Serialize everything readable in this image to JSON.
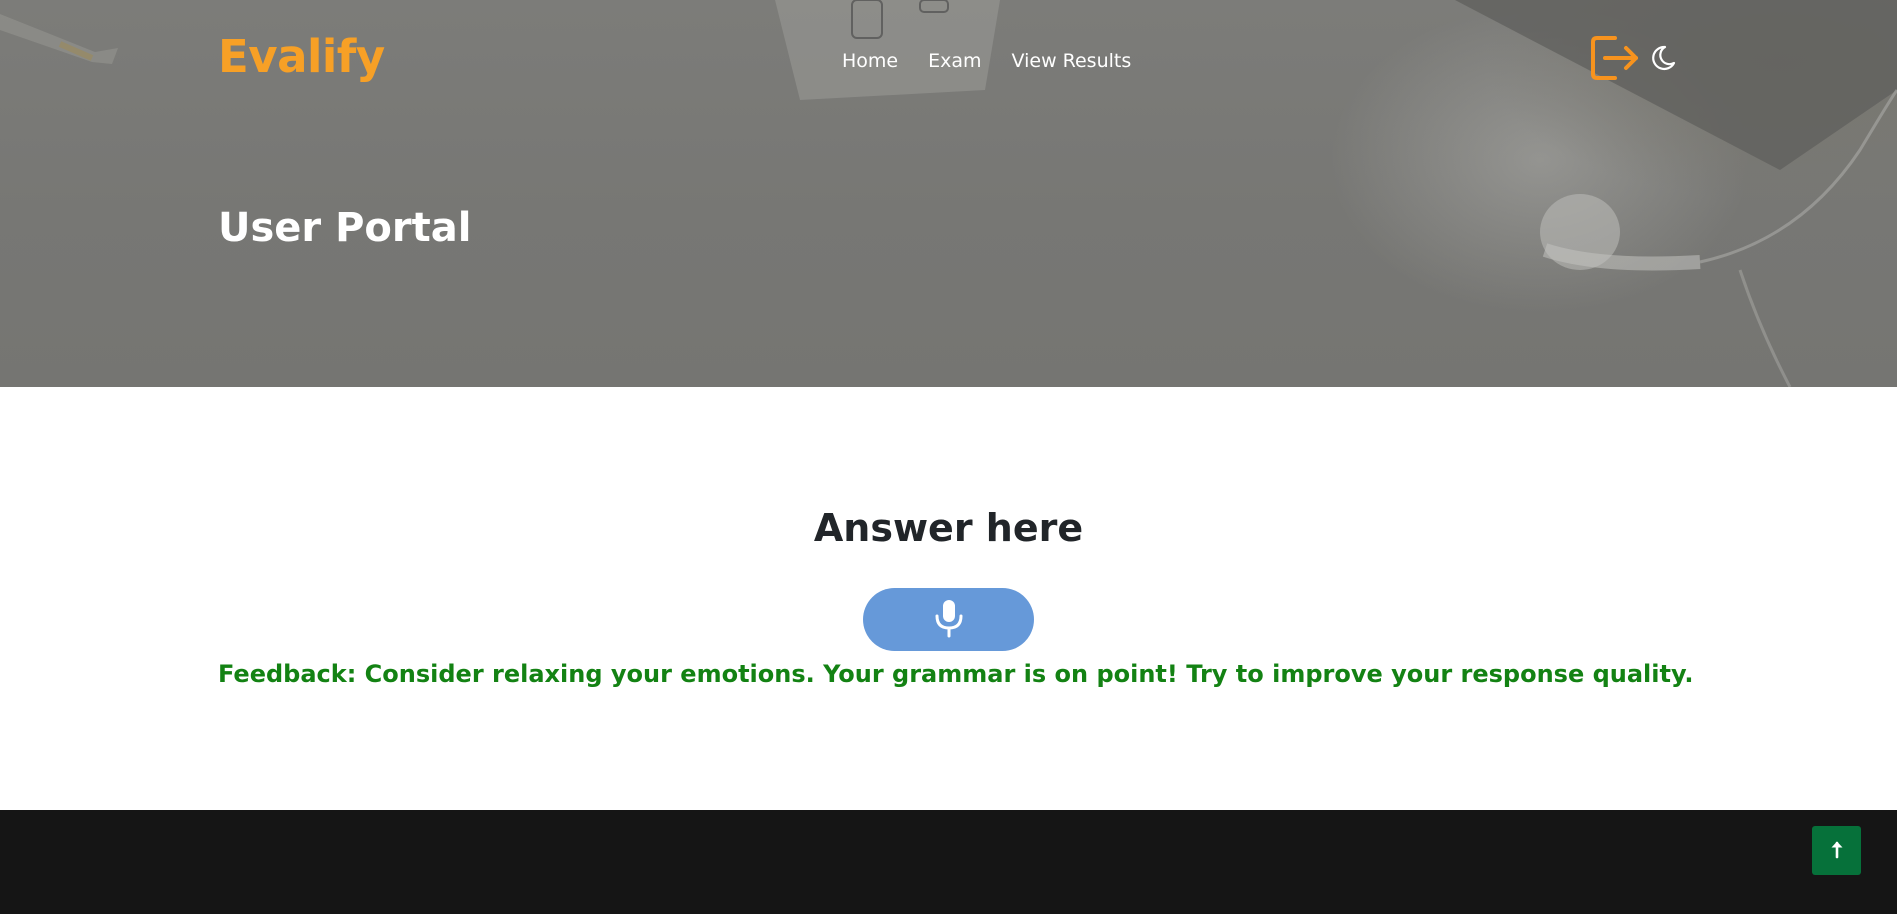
{
  "header": {
    "brand": "Evalify",
    "nav": [
      {
        "label": "Home"
      },
      {
        "label": "Exam"
      },
      {
        "label": "View Results"
      }
    ],
    "icons": {
      "logout": "logout-icon",
      "theme": "moon-icon"
    }
  },
  "hero": {
    "title": "User Portal"
  },
  "main": {
    "heading": "Answer here",
    "mic_icon": "microphone-icon",
    "feedback": "Feedback: Consider relaxing your emotions. Your grammar is on point! Try to improve your response quality."
  },
  "footer": {
    "back_to_top_icon": "arrow-up-icon"
  },
  "colors": {
    "brand": "#f7a026",
    "mic_button": "#6699d9",
    "feedback": "#138213",
    "footer": "#151515",
    "back_to_top": "#06713a"
  }
}
